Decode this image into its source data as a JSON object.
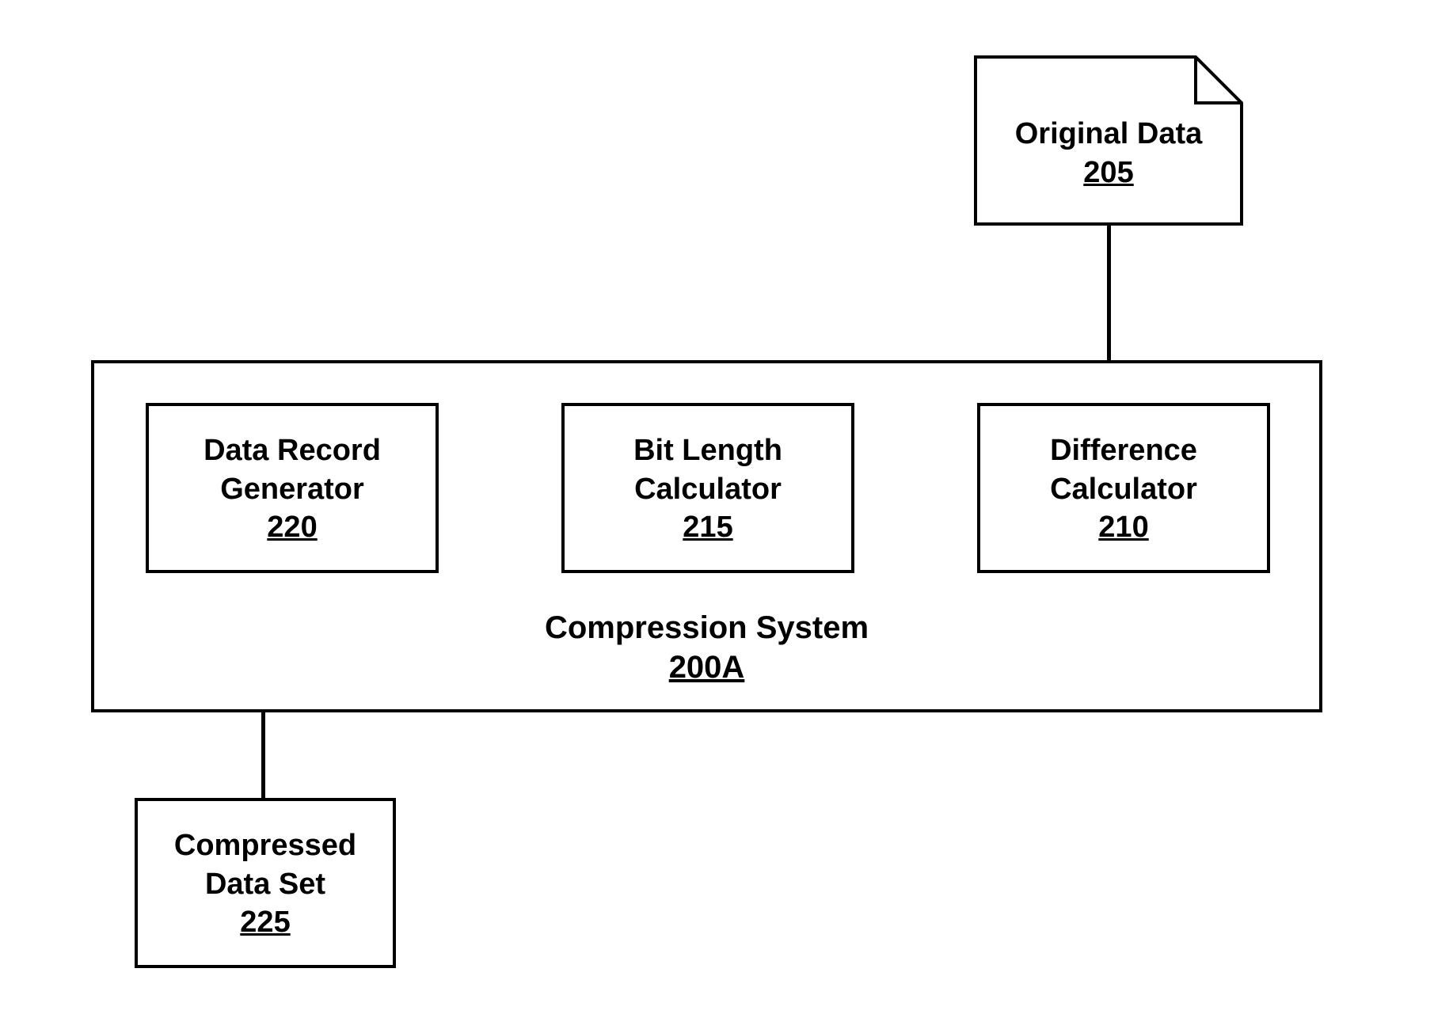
{
  "original_data": {
    "label": "Original Data",
    "number": "205"
  },
  "compression_system": {
    "label": "Compression System",
    "number": "200A",
    "components": {
      "data_record_generator": {
        "label_line1": "Data Record",
        "label_line2": "Generator",
        "number": "220"
      },
      "bit_length_calculator": {
        "label_line1": "Bit Length",
        "label_line2": "Calculator",
        "number": "215"
      },
      "difference_calculator": {
        "label_line1": "Difference",
        "label_line2": "Calculator",
        "number": "210"
      }
    }
  },
  "compressed_data_set": {
    "label_line1": "Compressed",
    "label_line2": "Data Set",
    "number": "225"
  }
}
